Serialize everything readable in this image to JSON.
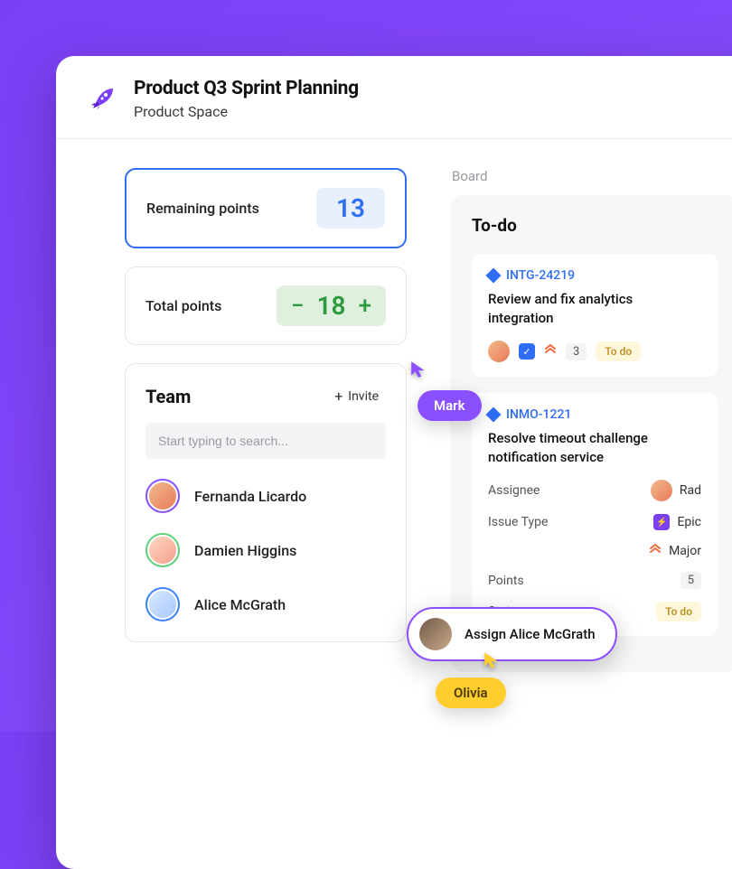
{
  "header": {
    "title": "Product Q3 Sprint Planning",
    "subtitle": "Product Space"
  },
  "points": {
    "remaining_label": "Remaining points",
    "remaining_value": "13",
    "total_label": "Total points",
    "total_value": "18"
  },
  "team": {
    "title": "Team",
    "invite_label": "Invite",
    "search_placeholder": "Start typing to search...",
    "members": [
      {
        "name": "Fernanda Licardo"
      },
      {
        "name": "Damien Higgins"
      },
      {
        "name": "Alice McGrath"
      }
    ]
  },
  "board": {
    "tab_label": "Board",
    "column_title": "To-do",
    "tickets": [
      {
        "id": "INTG-24219",
        "title": "Review and fix analytics integration",
        "points": "3",
        "status": "To do"
      },
      {
        "id": "INMO-1221",
        "title": "Resolve timeout challenge notification service",
        "details": {
          "assignee_label": "Assignee",
          "assignee_value": "Rad",
          "type_label": "Issue Type",
          "type_value": "Epic",
          "priority_label": "",
          "priority_value": "Major",
          "points_label": "Points",
          "points_value": "5",
          "status_label": "Status",
          "status_value": "To do"
        }
      }
    ]
  },
  "cursors": {
    "mark": "Mark",
    "olivia": "Olivia",
    "assign": "Assign Alice McGrath"
  }
}
